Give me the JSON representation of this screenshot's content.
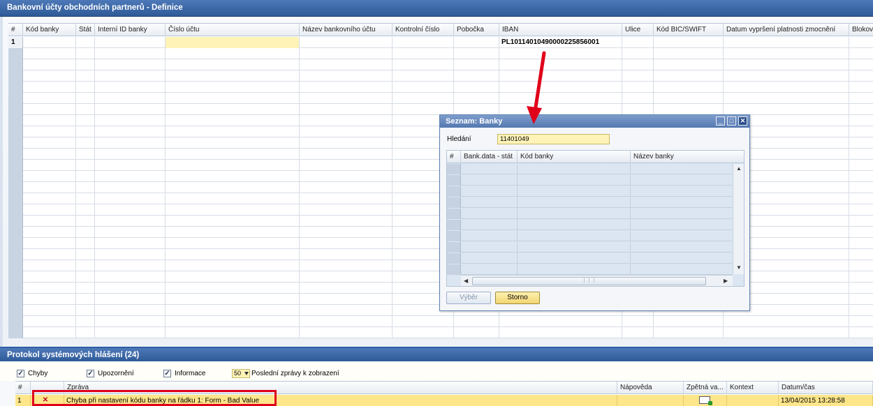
{
  "main_window": {
    "title": "Bankovní účty obchodních partnerů - Definice",
    "columns": [
      "#",
      "Kód banky",
      "Stát",
      "Interní ID banky",
      "Číslo účtu",
      "Název bankovního účtu",
      "Kontrolní číslo",
      "Pobočka",
      "IBAN",
      "Ulice",
      "Kód BIC/SWIFT",
      "Datum vypršení platnosti zmocnění",
      "Blokov"
    ],
    "rows": [
      {
        "num": "1",
        "iban": "PL10114010490000225856001"
      }
    ]
  },
  "dialog": {
    "title": "Seznam: Banky",
    "search_label": "Hledání",
    "search_value": "11401049",
    "columns": [
      "#",
      "Bank.data - stát",
      "Kód banky",
      "Název banky"
    ],
    "select_button": "Výběr",
    "cancel_button": "Storno",
    "minimize_icon": "minimize-icon",
    "maximize_icon": "maximize-icon",
    "close_icon": "close-icon"
  },
  "log_window": {
    "title": "Protokol systémových hlášení (24)",
    "checkboxes": [
      {
        "label": "Chyby",
        "checked": true
      },
      {
        "label": "Upozornění",
        "checked": true
      },
      {
        "label": "Informace",
        "checked": true
      }
    ],
    "count_value": "50",
    "count_label": "Poslední zprávy k zobrazení",
    "columns": [
      "#",
      "Zpráva",
      "Nápověda",
      "Zpětná va...",
      "Kontext",
      "Datum/čas"
    ],
    "rows": [
      {
        "num": "1",
        "message": "Chyba při nastavení kódu banky na řádku 1: Form - Bad Value",
        "datetime": "13/04/2015  13:28:58"
      }
    ]
  },
  "colors": {
    "titlebar": "#3a65a6",
    "highlight_yellow": "#fff3b8",
    "error_row": "#ffe68a",
    "annotation_red": "#e0001a"
  }
}
